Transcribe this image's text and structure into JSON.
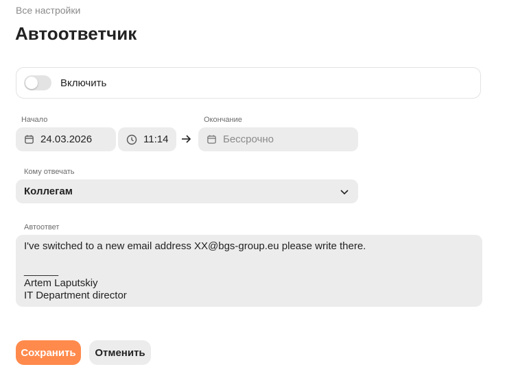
{
  "breadcrumb": "Все настройки",
  "title": "Автоответчик",
  "toggle": {
    "label": "Включить",
    "enabled": false
  },
  "start": {
    "label": "Начало",
    "date": "24.03.2026",
    "time": "11:14"
  },
  "end": {
    "label": "Окончание",
    "placeholder": "Бессрочно"
  },
  "reply_to": {
    "label": "Кому отвечать",
    "value": "Коллегам"
  },
  "autoreply": {
    "label": "Автоответ",
    "lines": [
      "I've switched to a new email address XX@bgs-group.eu please write there.",
      "",
      "______",
      "Artem Laputskiy",
      "IT Department director"
    ]
  },
  "buttons": {
    "save": "Сохранить",
    "cancel": "Отменить"
  },
  "colors": {
    "accent": "#ff8a4c",
    "field_bg": "#ececec"
  }
}
